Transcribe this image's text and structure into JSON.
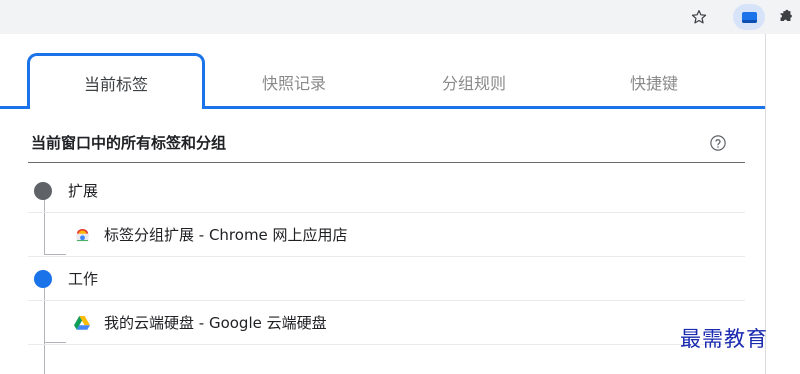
{
  "toolbar": {
    "icons": [
      "star-icon",
      "tab-groups-extension-icon",
      "puzzle-icon"
    ]
  },
  "tabs": [
    {
      "label": "当前标签",
      "active": true
    },
    {
      "label": "快照记录",
      "active": false
    },
    {
      "label": "分组规则",
      "active": false
    },
    {
      "label": "快捷键",
      "active": false
    }
  ],
  "section": {
    "title": "当前窗口中的所有标签和分组",
    "help_icon": "help-circle-icon"
  },
  "groups": [
    {
      "name": "扩展",
      "color": "#5f6368",
      "tabs": [
        {
          "title": "标签分组扩展 - Chrome 网上应用店",
          "icon": "chrome-webstore-icon"
        }
      ]
    },
    {
      "name": "工作",
      "color": "#1a73e8",
      "tabs": [
        {
          "title": "我的云端硬盘 - Google 云端硬盘",
          "icon": "google-drive-icon"
        }
      ]
    }
  ],
  "watermark": "最需教育",
  "colors": {
    "accent": "#1a73e8",
    "toolbar_bg": "#f1f3f4"
  }
}
